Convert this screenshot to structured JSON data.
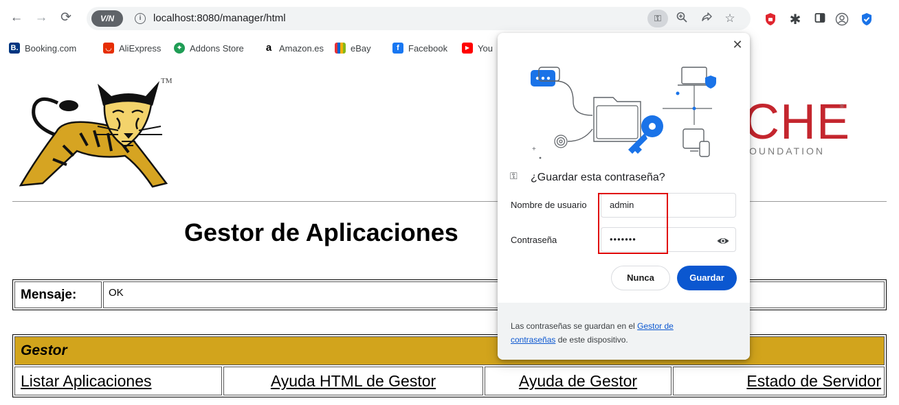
{
  "browser": {
    "url": "localhost:8080/manager/html",
    "vpn_label": "V/N",
    "nav": {
      "back": "←",
      "forward": "→",
      "reload": "⟳"
    }
  },
  "bookmarks": [
    {
      "label": "Booking.com",
      "icon": "B.",
      "color": "#003580"
    },
    {
      "label": "AliExpress",
      "icon": "◡",
      "color": "#e62e04"
    },
    {
      "label": "Addons Store",
      "icon": "✦",
      "color": "#1f9d55"
    },
    {
      "label": "Amazon.es",
      "icon": "a",
      "color": "#000000"
    },
    {
      "label": "eBay",
      "icon": "▬",
      "color": "#e53238"
    },
    {
      "label": "Facebook",
      "icon": "f",
      "color": "#1877f2"
    },
    {
      "label": "You",
      "icon": "▶",
      "color": "#ff0000"
    }
  ],
  "page": {
    "tm": "TM",
    "apache_text": "CHE",
    "apache_reg": "®",
    "foundation_text": "OUNDATION",
    "title": "Gestor de Aplicaciones",
    "message_label": "Mensaje:",
    "message_value": "OK",
    "manager_header": "Gestor",
    "manager_links": [
      "Listar Aplicaciones",
      "Ayuda HTML de Gestor",
      "Ayuda de Gestor",
      "Estado de Servidor"
    ]
  },
  "popup": {
    "question": "¿Guardar esta contraseña?",
    "username_label": "Nombre de usuario",
    "username_value": "admin",
    "password_label": "Contraseña",
    "password_value": "•••••••",
    "never_button": "Nunca",
    "save_button": "Guardar",
    "footer_before": "Las contraseñas se guardan en el ",
    "footer_link_1": "Gestor de",
    "footer_link_2": "contraseñas",
    "footer_after": " de este dispositivo."
  },
  "colors": {
    "accent_blue": "#0b57d0",
    "tomcat_gold": "#d2a41c",
    "apache_red": "#c4262e",
    "highlight_red": "#e00000"
  }
}
